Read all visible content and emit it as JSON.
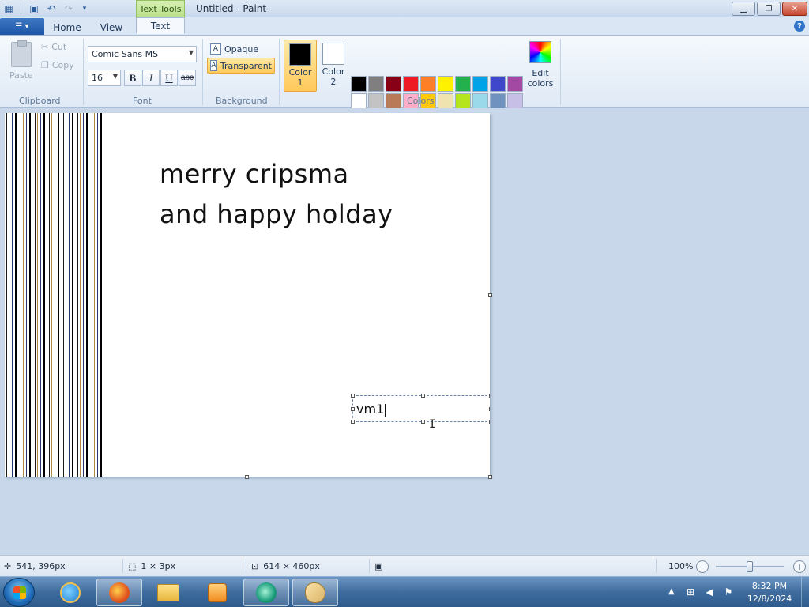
{
  "window": {
    "title": "Untitled - Paint",
    "context_tab_group": "Text Tools"
  },
  "tabs": {
    "home": "Home",
    "view": "View",
    "text": "Text"
  },
  "clipboard": {
    "paste": "Paste",
    "cut": "Cut",
    "copy": "Copy",
    "group_label": "Clipboard"
  },
  "font": {
    "family": "Comic Sans MS",
    "size": "16",
    "bold": "B",
    "italic": "I",
    "underline": "U",
    "strikethrough": "abc",
    "group_label": "Font"
  },
  "background": {
    "opaque": "Opaque",
    "transparent": "Transparent",
    "selected": "transparent",
    "group_label": "Background"
  },
  "colors": {
    "color1_label_a": "Color",
    "color1_label_b": "1",
    "color2_label_a": "Color",
    "color2_label_b": "2",
    "color1": "#000000",
    "color2": "#ffffff",
    "palette": [
      "#000000",
      "#7f7f7f",
      "#880015",
      "#ed1c24",
      "#ff7f27",
      "#fff200",
      "#22b14c",
      "#00a2e8",
      "#3f48cc",
      "#a349a4",
      "#ffffff",
      "#c3c3c3",
      "#b97a57",
      "#ffaec9",
      "#ffc90e",
      "#efe4b0",
      "#b5e61d",
      "#99d9ea",
      "#7092be",
      "#c8bfe7"
    ],
    "empty_slots": 10,
    "edit_colors_a": "Edit",
    "edit_colors_b": "colors",
    "group_label": "Colors"
  },
  "canvas": {
    "text_line1": "merry cripsma",
    "text_line2": "and happy holday",
    "textbox_value": "vm1"
  },
  "status": {
    "cursor_position": "541, 396px",
    "selection_size": "1 × 3px",
    "canvas_size": "614 × 460px",
    "zoom": "100%",
    "zoom_fraction": 0.5
  },
  "taskbar": {
    "time": "8:32 PM",
    "date": "12/8/2024"
  }
}
